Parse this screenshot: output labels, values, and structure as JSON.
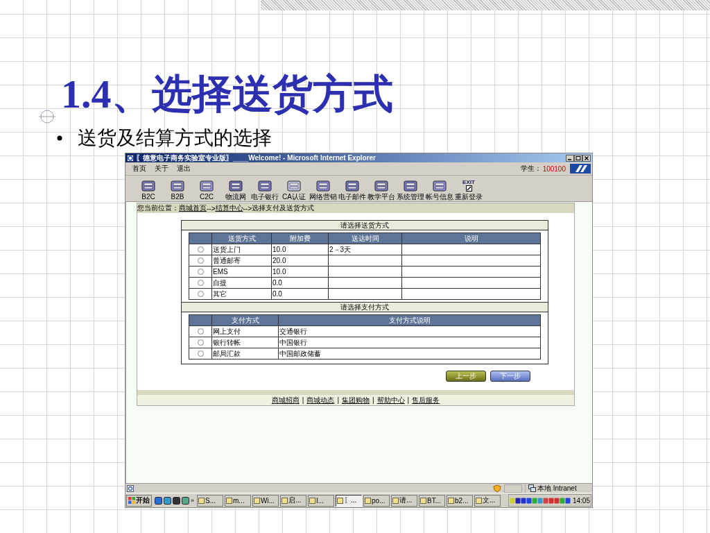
{
  "slide": {
    "title": "1.4、选择送货方式",
    "bullet": "送货及结算方式的选择"
  },
  "window": {
    "title": "〖德意电子商务实验室专业版〗____Welcome! - Microsoft Internet Explorer",
    "menu": [
      "首页",
      "关于",
      "退出"
    ],
    "student_label": "学生：",
    "student_id": "100100",
    "toolbar": [
      {
        "label": "B2C"
      },
      {
        "label": "B2B"
      },
      {
        "label": "C2C"
      },
      {
        "label": "物流网"
      },
      {
        "label": "电子银行"
      },
      {
        "label": "CA认证"
      },
      {
        "label": "网络营销"
      },
      {
        "label": "电子邮件"
      },
      {
        "label": "教学平台"
      },
      {
        "label": "系统管理"
      },
      {
        "label": "帐号信息"
      },
      {
        "label": "重新登录",
        "icon_text": "EXIT"
      }
    ],
    "breadcrumb": {
      "label": "您当前位置：",
      "links": [
        "商城首页",
        "结算中心"
      ],
      "separator": "-->",
      "current": "选择支付及送货方式"
    },
    "shipping": {
      "title": "请选择送货方式",
      "columns": [
        "送货方式",
        "附加费",
        "送达时间",
        "说明"
      ],
      "rows": [
        {
          "selected": false,
          "cells": [
            "送货上门",
            "10.0",
            "2－3天",
            ""
          ]
        },
        {
          "selected": false,
          "cells": [
            "普通邮寄",
            "20.0",
            "",
            ""
          ]
        },
        {
          "selected": false,
          "cells": [
            "EMS",
            "10.0",
            "",
            ""
          ]
        },
        {
          "selected": false,
          "cells": [
            "自提",
            "0.0",
            "",
            ""
          ]
        },
        {
          "selected": false,
          "cells": [
            "其它",
            "0.0",
            "",
            ""
          ]
        }
      ]
    },
    "payment": {
      "title": "请选择支付方式",
      "columns": [
        "支付方式",
        "支付方式说明"
      ],
      "rows": [
        {
          "selected": false,
          "cells": [
            "网上支付",
            "交通银行"
          ]
        },
        {
          "selected": false,
          "cells": [
            "银行转帐",
            "中国银行"
          ]
        },
        {
          "selected": false,
          "cells": [
            "邮局汇款",
            "中国邮政储蓄"
          ]
        }
      ]
    },
    "buttons": [
      {
        "label": "上一步",
        "kind": "back"
      },
      {
        "label": "下一步",
        "kind": "next"
      }
    ],
    "footer": {
      "links": [
        "商城招商",
        "商城动态",
        "集团购物",
        "帮助中心",
        "售后服务"
      ],
      "separator": "|"
    },
    "status_bar": {
      "zone": "本地 Intranet"
    },
    "taskbar": {
      "start": "开始",
      "more": "»",
      "tasks": [
        {
          "label": "S...",
          "selected": false
        },
        {
          "label": "m...",
          "selected": false
        },
        {
          "label": "Wi...",
          "selected": false
        },
        {
          "label": "启...",
          "selected": false
        },
        {
          "label": "I...",
          "selected": false
        },
        {
          "label": "〖...",
          "selected": true
        },
        {
          "label": "po...",
          "selected": false
        },
        {
          "label": "请...",
          "selected": false
        },
        {
          "label": "BT...",
          "selected": false
        },
        {
          "label": "b2...",
          "selected": false
        },
        {
          "label": "文...",
          "selected": false
        }
      ],
      "clock": "14:05"
    }
  }
}
